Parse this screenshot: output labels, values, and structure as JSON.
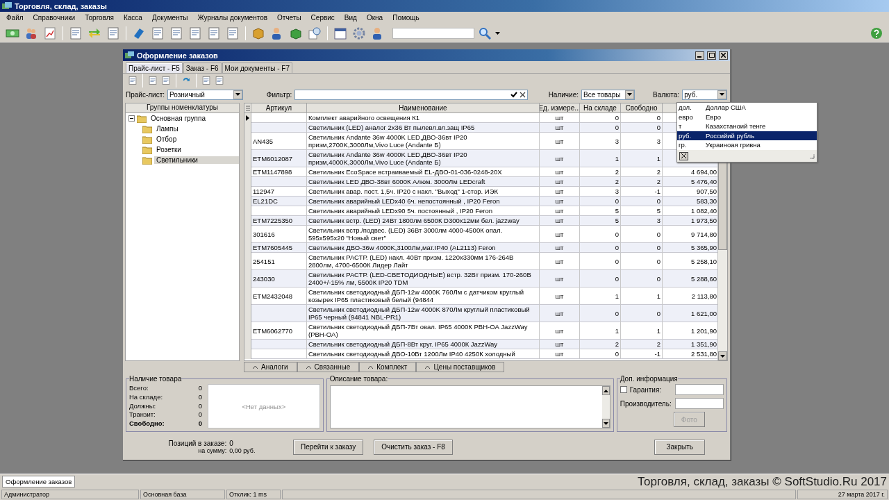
{
  "window": {
    "title": "Торговля, склад, заказы"
  },
  "menu": [
    "Файл",
    "Справочники",
    "Торговля",
    "Касса",
    "Документы",
    "Журналы документов",
    "Отчеты",
    "Сервис",
    "Вид",
    "Окна",
    "Помощь"
  ],
  "child_window": {
    "title": "Оформление заказов",
    "tabs": [
      {
        "label": "Прайс-лист - F5",
        "selected": true
      },
      {
        "label": "Заказ - F6",
        "selected": false
      },
      {
        "label": "Мои документы - F7",
        "selected": false
      }
    ],
    "filters": {
      "price_list": {
        "label": "Прайс-лист:",
        "value": "Розничный"
      },
      "filter": {
        "label": "Фильтр:"
      },
      "availability": {
        "label": "Наличие:",
        "value": "Все товары"
      },
      "currency": {
        "label": "Валюта:",
        "value": "руб."
      }
    },
    "groups": {
      "header": "Группы номенклатуры",
      "tree": [
        {
          "label": "Основная группа",
          "expanded": true,
          "selected": false,
          "children": [
            {
              "label": "Лампы",
              "selected": false
            },
            {
              "label": "Отбор",
              "selected": false
            },
            {
              "label": "Розетки",
              "selected": false
            },
            {
              "label": "Светильники",
              "selected": true
            }
          ]
        }
      ]
    },
    "table": {
      "columns": [
        "Артикул",
        "Наименование",
        "Ед. измере...",
        "На складе",
        "Свободно"
      ],
      "rows": [
        {
          "article": "",
          "name": "Комплект аварийного освещения К1",
          "unit": "шт",
          "stock": "0",
          "free": "0",
          "selected": true
        },
        {
          "article": "",
          "name": "Светильник   (LED) аналог 2х36 Вт пылевл.вл.защ IP65",
          "unit": "шт",
          "stock": "0",
          "free": "0",
          "selected": false
        },
        {
          "article": "AN435",
          "name": "Светильник Andante 36w 4000K LED,ДВО-36вт IP20 призм,2700K,3000Лм,Vivo Luce (Andante Б)",
          "unit": "шт",
          "stock": "3",
          "free": "3",
          "selected": false
        },
        {
          "article": "ETM6012087",
          "name": "Светильник Andante 36w 4000K LED,ДВО-36вт IP20 призм,4000K,3000Лм,Vivo Luce (Andante Б)",
          "unit": "шт",
          "stock": "1",
          "free": "1",
          "selected": false
        },
        {
          "article": "ETM1147898",
          "name": "Светильник EcoSpace встраиваемый EL-ДВО-01-036-0248-20Х",
          "unit": "шт",
          "stock": "2",
          "free": "2",
          "price": "4 694,00",
          "selected": false
        },
        {
          "article": "",
          "name": "Светильник LED ДВО-38вт 6000К Алюм. 3000Лм LEDcraft",
          "unit": "шт",
          "stock": "2",
          "free": "2",
          "price": "5 476,40",
          "selected": false
        },
        {
          "article": "112947",
          "name": "Светильник авар. пост. 1,5ч. IP20 с накл. \"Выход\" 1-стор.  ИЭК",
          "unit": "шт",
          "stock": "3",
          "free": "-1",
          "price": "907,50",
          "selected": false
        },
        {
          "article": "EL21DC",
          "name": "Светильник аварийный LEDx40 6ч. непостоянный , IP20 Feron",
          "unit": "шт",
          "stock": "0",
          "free": "0",
          "price": "583,30",
          "selected": false
        },
        {
          "article": "",
          "name": "Светильник аварийный LEDx90 5ч. постоянный , IP20 Feron",
          "unit": "шт",
          "stock": "5",
          "free": "5",
          "price": "1 082,40",
          "selected": false
        },
        {
          "article": "ETM7225350",
          "name": "Светильник встр. (LED) 24Вт 1800лм 6500К D300х12мм бел. jazzway",
          "unit": "шт",
          "stock": "5",
          "free": "3",
          "price": "1 973,50",
          "selected": false
        },
        {
          "article": "301616",
          "name": "Светильник встр./подвес. (LED) 36Вт 3000лм 4000-4500К опал. 595х595х20 \"Новый свет\"",
          "unit": "шт",
          "stock": "0",
          "free": "0",
          "price": "9 714,80",
          "selected": false
        },
        {
          "article": "ETM7605445",
          "name": "Светильник ДВО-36w 4000K,3100Лм,мат.IP40  (AL2113) Feron",
          "unit": "шт",
          "stock": "0",
          "free": "0",
          "price": "5 365,90",
          "selected": false
        },
        {
          "article": "254151",
          "name": "Светильник РАСТР. (LED) накл. 40Вт призм. 1220х330мм 176-264В 2800лм, 4700-6500К Лидер Лайт",
          "unit": "шт",
          "stock": "0",
          "free": "0",
          "price": "5 258,10",
          "selected": false
        },
        {
          "article": "243030",
          "name": "Светильник РАСТР. (LED-СВЕТОДИОДНЫЕ) встр. 32Вт призм. 170-260В 2400+/-15% лм, 5500К IP20 TDM",
          "unit": "шт",
          "stock": "0",
          "free": "0",
          "price": "5 288,60",
          "selected": false
        },
        {
          "article": "ETM2432048",
          "name": "Светильник светодиодный ДБП-12w 4000K 760Лм с датчиком круглый козырек IP65 пластиковый белый (94844",
          "unit": "шт",
          "stock": "1",
          "free": "1",
          "price": "2 113,80",
          "selected": false
        },
        {
          "article": "",
          "name": "Светильник светодиодный ДБП-12w 4000K 870Лм круглый пластиковый IP65 черный (94841 NBL-PR1)",
          "unit": "шт",
          "stock": "0",
          "free": "0",
          "price": "1 621,00",
          "selected": false
        },
        {
          "article": "ETM6062770",
          "name": "Светильник светодиодный ДБП-7Вт овал. IP65 4000К РВН-ОА JazzWay (РВН-ОА)",
          "unit": "шт",
          "stock": "1",
          "free": "1",
          "price": "1 201,90",
          "selected": false
        },
        {
          "article": "",
          "name": "Светильник светодиодный ДБП-8Вт круг. IP65 4000К JazzWay",
          "unit": "шт",
          "stock": "2",
          "free": "2",
          "price": "1 351,90",
          "selected": false
        },
        {
          "article": "",
          "name": "Светильник светодиодный ДВО-10Вт 1200Лм IP40 4250К холодный",
          "unit": "шт",
          "stock": "0",
          "free": "-1",
          "price": "2 531,80",
          "selected": false
        }
      ]
    },
    "detail_tabs": [
      "Аналоги",
      "Связанные",
      "Комплект",
      "Цены поставщиков"
    ],
    "stock_panel": {
      "title": "Наличие товара",
      "rows": [
        {
          "label": "Всего:",
          "value": "0",
          "kind": "normal"
        },
        {
          "label": "На складе:",
          "value": "0",
          "kind": "normal"
        },
        {
          "label": "Должны:",
          "value": "0",
          "kind": "normal"
        },
        {
          "label": "Транзит:",
          "value": "0",
          "kind": "normal"
        },
        {
          "label": "Свободно:",
          "value": "0",
          "kind": "total"
        }
      ],
      "empty_text": "<Нет данных>"
    },
    "description": {
      "title": "Описание товара:"
    },
    "extra": {
      "title": "Доп. информация",
      "warranty": {
        "label": "Гарантия:",
        "checked": false
      },
      "manufacturer_label": "Производитель:",
      "photo_button": {
        "label": "Фото",
        "disabled": true
      }
    },
    "summary": {
      "positions_label": "Позиций в заказе:",
      "positions": "0",
      "sum_label": "на сумму:",
      "sum": "0,00 руб."
    },
    "buttons": [
      "Перейти к заказу",
      "Очистить заказ - F8"
    ],
    "close_button": "Закрыть",
    "currency_dropdown": [
      {
        "code": "дол.",
        "name": "Доллар США",
        "selected": false
      },
      {
        "code": "евро",
        "name": "Евро",
        "selected": false
      },
      {
        "code": "т",
        "name": "Казахстаноий тенге",
        "selected": false
      },
      {
        "code": "руб.",
        "name": "Российий рубль",
        "selected": true
      },
      {
        "code": "гр.",
        "name": "Украиноая гривна",
        "selected": false
      }
    ]
  },
  "taskbar": {
    "tabs": [
      {
        "label": "Оформление заказов",
        "selected": true
      }
    ],
    "brand": "Торговля, склад, заказы © SoftStudio.Ru 2017"
  },
  "status_bar": [
    "Администратор",
    "Основная база",
    "Отклик: 1 ms",
    "27 марта 2017 г."
  ]
}
